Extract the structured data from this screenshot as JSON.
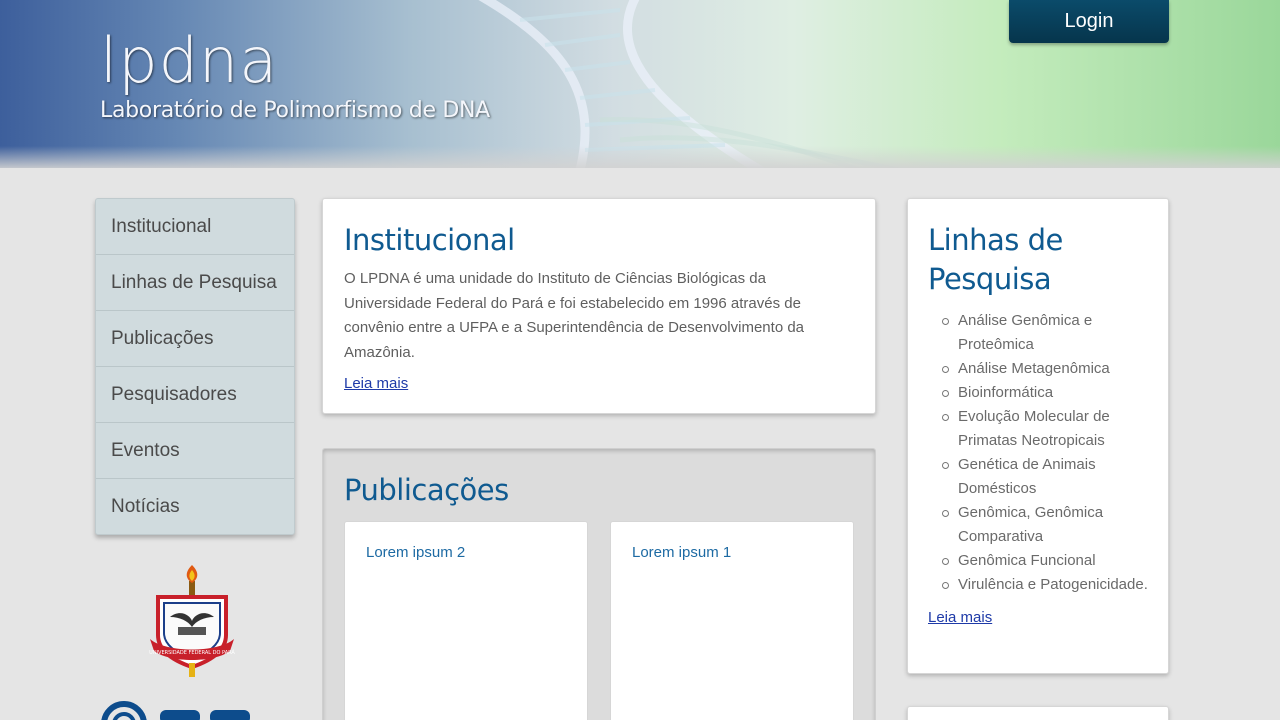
{
  "header": {
    "logo_text": "lpdna",
    "subtitle": "Laboratório de Polimorfismo de DNA",
    "login_label": "Login"
  },
  "nav": {
    "items": [
      {
        "label": "Institucional"
      },
      {
        "label": "Linhas de Pesquisa"
      },
      {
        "label": "Publicações"
      },
      {
        "label": "Pesquisadores"
      },
      {
        "label": "Eventos"
      },
      {
        "label": "Notícias"
      }
    ]
  },
  "institutional": {
    "title": "Institucional",
    "body": "O LPDNA é uma unidade do Instituto de Ciências Biológicas da Universidade Federal do Pará e foi estabelecido em 1996 através de convênio entre a UFPA e a Superintendência de Desenvolvimento da Amazônia.",
    "read_more": "Leia mais"
  },
  "publications": {
    "title": "Publicações",
    "items": [
      {
        "title": "Lorem ipsum 2"
      },
      {
        "title": "Lorem ipsum 1"
      }
    ]
  },
  "research_lines": {
    "title": "Linhas de Pesquisa",
    "items": [
      "Análise Genômica e Proteômica",
      "Análise Metagenômica",
      "Bioinformática",
      "Evolução Molecular de Primatas Neotropicais",
      "Genética de Animais Domésticos",
      "Genômica, Genômica Comparativa",
      "Genômica Funcional",
      "Virulência e Patogenicidade."
    ],
    "read_more": "Leia mais"
  },
  "crest": {
    "text": "UNIVERSIDADE FEDERAL DO PARÁ"
  },
  "colors": {
    "accent": "#0f5a90",
    "login_bg": "#06354c",
    "nav_bg": "#d0dbde",
    "link": "#1e3aa8",
    "page_bg": "#e5e5e5"
  }
}
